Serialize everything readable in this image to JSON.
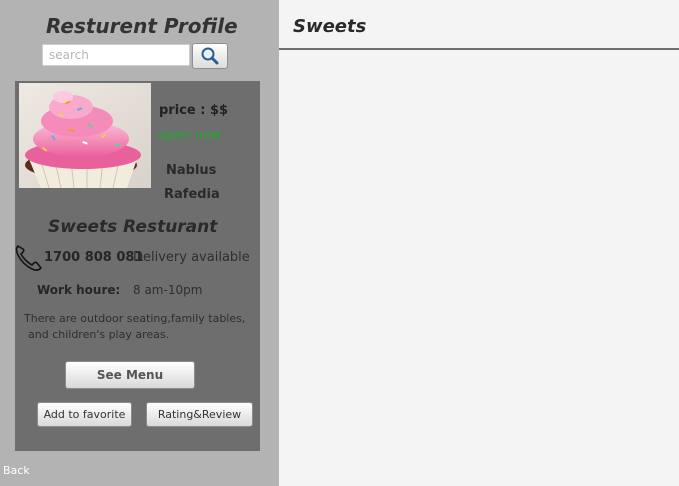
{
  "sidebar": {
    "title": "Resturent Profile",
    "search": {
      "placeholder": "search",
      "value": "",
      "icon": "search-icon"
    },
    "back_label": "Back"
  },
  "restaurant": {
    "photo": "cupcake-photo",
    "price": "price : $$",
    "status": "open now",
    "status_color": "#1faa2b",
    "city": "Nablus",
    "area": "Rafedia",
    "name": "Sweets Resturant",
    "phone_icon": "phone-icon",
    "phone": "1700 808 081",
    "delivery": "Delivery available",
    "hours_label": "Work houre:",
    "hours": "8 am-10pm",
    "description_line1": "There are outdoor seating,family tables,",
    "description_line2": "and children's play areas."
  },
  "actions": {
    "see_menu": "See Menu",
    "add_favorite": "Add to favorite",
    "rating_review": "Rating&Review"
  },
  "content": {
    "title": "Sweets"
  },
  "colors": {
    "sidebar_bg": "#b3b3b3",
    "card_bg": "#6e6e6e",
    "content_bg": "#f4f4f4"
  }
}
